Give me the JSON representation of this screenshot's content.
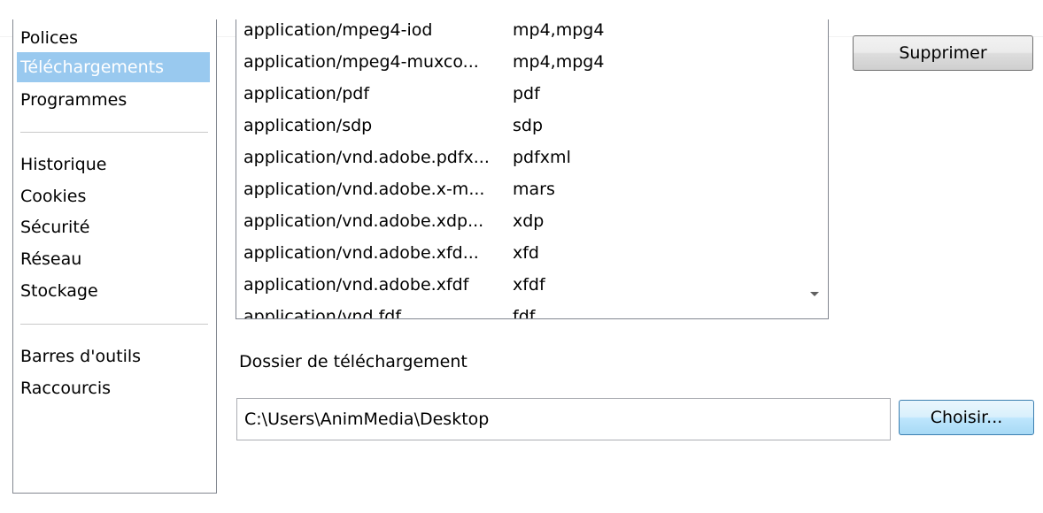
{
  "sidebar": {
    "items": [
      {
        "label": "Polices"
      },
      {
        "label": "Téléchargements",
        "selected": true
      },
      {
        "label": "Programmes"
      },
      {
        "label": "Historique"
      },
      {
        "label": "Cookies"
      },
      {
        "label": "Sécurité"
      },
      {
        "label": "Réseau"
      },
      {
        "label": "Stockage"
      },
      {
        "label": "Barres d'outils"
      },
      {
        "label": "Raccourcis"
      }
    ]
  },
  "mime_list": {
    "rows": [
      {
        "type": "application/mpeg4-iod",
        "ext": "mp4,mpg4"
      },
      {
        "type": "application/mpeg4-muxco...",
        "ext": "mp4,mpg4"
      },
      {
        "type": "application/pdf",
        "ext": "pdf"
      },
      {
        "type": "application/sdp",
        "ext": "sdp"
      },
      {
        "type": "application/vnd.adobe.pdfx...",
        "ext": "pdfxml"
      },
      {
        "type": "application/vnd.adobe.x-m...",
        "ext": "mars"
      },
      {
        "type": "application/vnd.adobe.xdp...",
        "ext": "xdp"
      },
      {
        "type": "application/vnd.adobe.xfd...",
        "ext": "xfd"
      },
      {
        "type": "application/vnd.adobe.xfdf",
        "ext": "xfdf"
      },
      {
        "type": "application/vnd.fdf",
        "ext": "fdf"
      }
    ]
  },
  "buttons": {
    "delete_label": "Supprimer",
    "choose_label": "Choisir..."
  },
  "download": {
    "folder_label": "Dossier de téléchargement",
    "folder_value": "C:\\Users\\AnimMedia\\Desktop"
  },
  "colors": {
    "selection": "#99c9ef",
    "border": "#828790"
  },
  "icons": {
    "scroll_down": "triangle-down"
  }
}
